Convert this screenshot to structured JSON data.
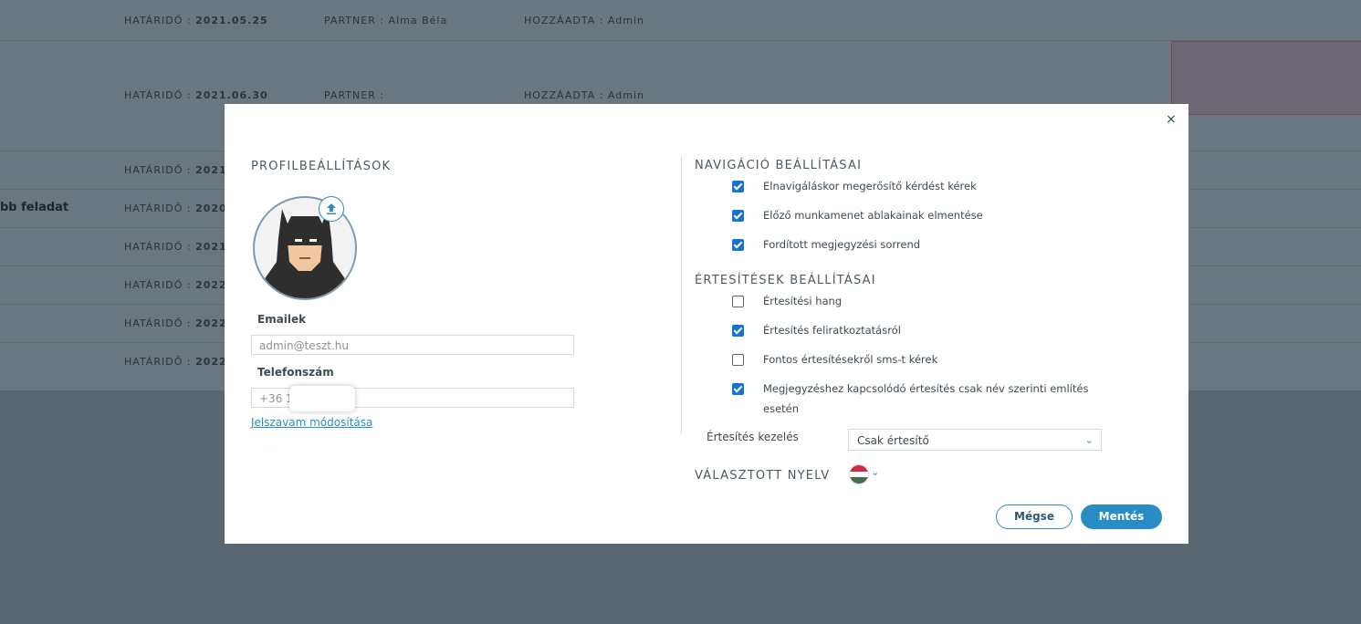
{
  "background": {
    "rows": [
      {
        "hatarido_label": "HATÁRIDŐ :",
        "hatarido": "2021.05.25",
        "partner": "PARTNER : Alma Béla",
        "hozzaadta": "HOZZÁADTA : Admin"
      },
      {
        "hatarido_label": "HATÁRIDŐ :",
        "hatarido": "2021.06.30",
        "partner": "PARTNER :",
        "hozzaadta": "HOZZÁADTA : Admin"
      },
      {
        "hatarido_label": "HATÁRIDŐ :",
        "hatarido": "2021."
      },
      {
        "hatarido_label": "HATÁRIDŐ :",
        "hatarido": "2020."
      },
      {
        "hatarido_label": "HATÁRIDŐ :",
        "hatarido": "2021."
      },
      {
        "hatarido_label": "HATÁRIDŐ :",
        "hatarido": "2022."
      },
      {
        "hatarido_label": "HATÁRIDŐ :",
        "hatarido": "2022."
      },
      {
        "hatarido_label": "HATÁRIDŐ :",
        "hatarido": "2022."
      }
    ],
    "task_fragment": "bb feladat"
  },
  "modal": {
    "close_glyph": "×",
    "profile_title": "PROFILBEÁLLÍTÁSOK",
    "email_label": "Emailek",
    "email_value": "admin@teszt.hu",
    "phone_label": "Telefonszám",
    "phone_value": "+36 1",
    "password_link": "Jelszavam módosítása",
    "nav_title": "NAVIGÁCIÓ BEÁLLÍTÁSAI",
    "nav_options": [
      {
        "label": "Elnavigáláskor megerősítő kérdést kérek",
        "checked": true
      },
      {
        "label": "Előző munkamenet ablakainak elmentése",
        "checked": true
      },
      {
        "label": "Fordított megjegyzési sorrend",
        "checked": true
      }
    ],
    "notif_title": "ÉRTESÍTÉSEK BEÁLLÍTÁSAI",
    "notif_options": [
      {
        "label": "Értesítési hang",
        "checked": false
      },
      {
        "label": "Értesítés feliratkoztatásról",
        "checked": true
      },
      {
        "label": "Fontos értesítésekről sms-t kérek",
        "checked": false
      },
      {
        "label": "Megjegyzéshez kapcsolódó értesítés csak név szerinti említés esetén",
        "checked": true
      }
    ],
    "notif_handling_label": "Értesítés kezelés",
    "notif_handling_value": "Csak értesítő",
    "language_label": "VÁLASZTOTT NYELV",
    "language_flag_colors": [
      "#cd2a3e",
      "#ffffff",
      "#436f4d"
    ],
    "cancel_label": "Mégse",
    "save_label": "Mentés",
    "accent_color": "#2a8cc4"
  }
}
